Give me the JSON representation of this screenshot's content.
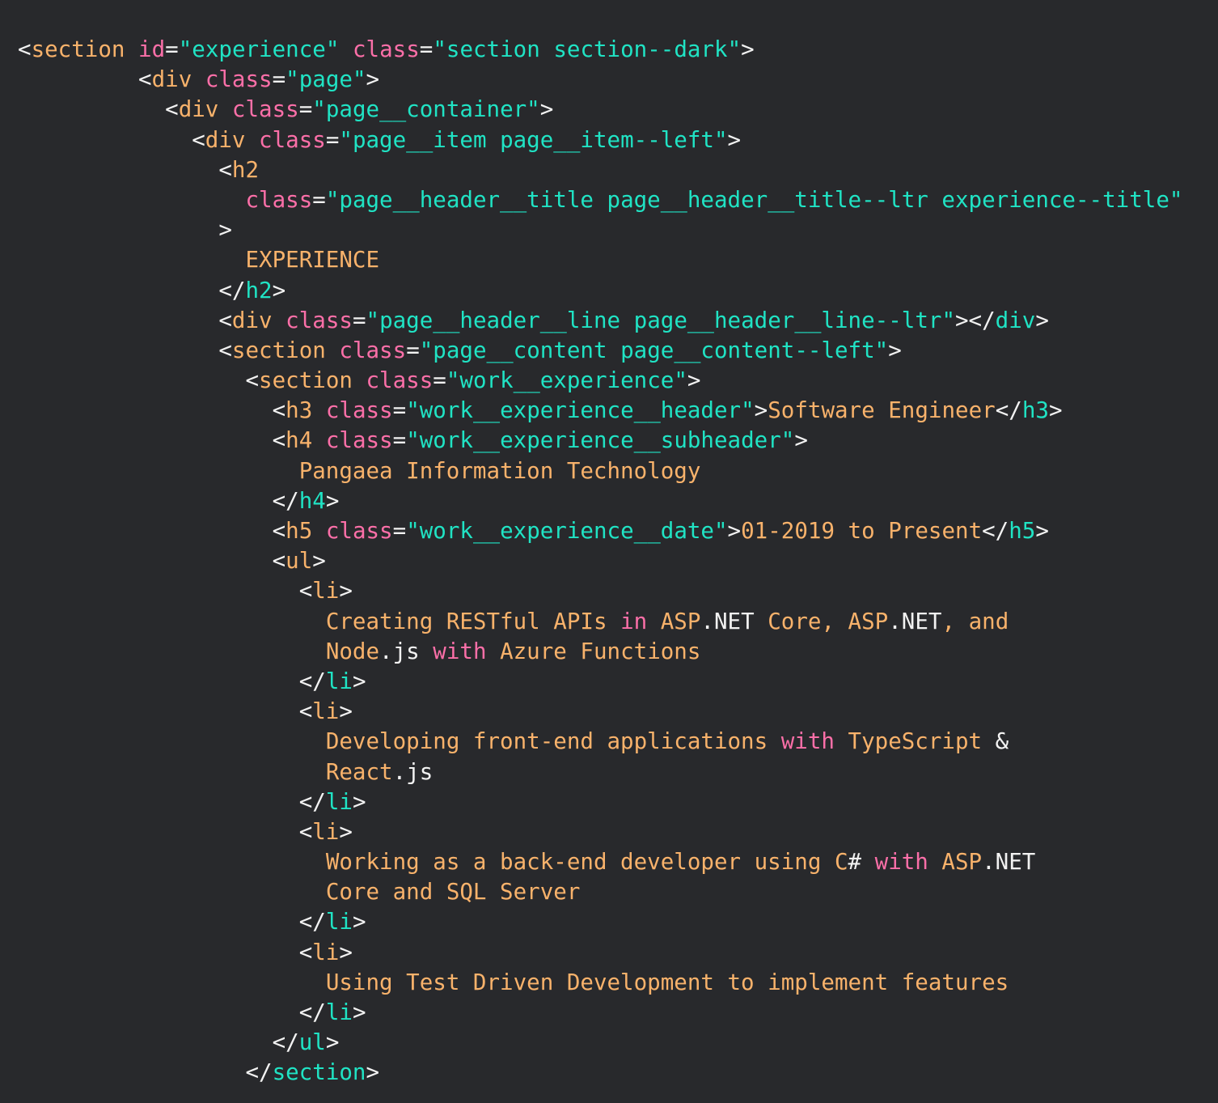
{
  "editor": {
    "theme": {
      "background": "#28292c",
      "punctuation": "#f2f2f2",
      "tag_name": "#f8b26b",
      "closing_tag_name": "#20e3c4",
      "attribute_name": "#fb6fa8",
      "string": "#20e3c4",
      "text": "#f8b26b",
      "keyword": "#fb6fa8",
      "plain": "#f2f2f2"
    },
    "lines": [
      {
        "indent": 0,
        "tokens": [
          [
            "punct",
            "<"
          ],
          [
            "tag",
            "section"
          ],
          [
            "plain",
            " "
          ],
          [
            "attr",
            "id"
          ],
          [
            "punct",
            "="
          ],
          [
            "str",
            "\"experience\""
          ],
          [
            "plain",
            " "
          ],
          [
            "attr",
            "class"
          ],
          [
            "punct",
            "="
          ],
          [
            "str",
            "\"section section--dark\""
          ],
          [
            "punct",
            ">"
          ]
        ]
      },
      {
        "indent": 9,
        "tokens": [
          [
            "punct",
            "<"
          ],
          [
            "tag",
            "div"
          ],
          [
            "plain",
            " "
          ],
          [
            "attr",
            "class"
          ],
          [
            "punct",
            "="
          ],
          [
            "str",
            "\"page\""
          ],
          [
            "punct",
            ">"
          ]
        ]
      },
      {
        "indent": 11,
        "tokens": [
          [
            "punct",
            "<"
          ],
          [
            "tag",
            "div"
          ],
          [
            "plain",
            " "
          ],
          [
            "attr",
            "class"
          ],
          [
            "punct",
            "="
          ],
          [
            "str",
            "\"page__container\""
          ],
          [
            "punct",
            ">"
          ]
        ]
      },
      {
        "indent": 13,
        "tokens": [
          [
            "punct",
            "<"
          ],
          [
            "tag",
            "div"
          ],
          [
            "plain",
            " "
          ],
          [
            "attr",
            "class"
          ],
          [
            "punct",
            "="
          ],
          [
            "str",
            "\"page__item page__item--left\""
          ],
          [
            "punct",
            ">"
          ]
        ]
      },
      {
        "indent": 15,
        "tokens": [
          [
            "punct",
            "<"
          ],
          [
            "tag",
            "h2"
          ]
        ]
      },
      {
        "indent": 17,
        "tokens": [
          [
            "attr",
            "class"
          ],
          [
            "punct",
            "="
          ],
          [
            "str",
            "\"page__header__title page__header__title--ltr experience--title\""
          ]
        ]
      },
      {
        "indent": 15,
        "tokens": [
          [
            "punct",
            ">"
          ]
        ]
      },
      {
        "indent": 17,
        "tokens": [
          [
            "text",
            "EXPERIENCE"
          ]
        ]
      },
      {
        "indent": 15,
        "tokens": [
          [
            "punct",
            "</"
          ],
          [
            "ctag",
            "h2"
          ],
          [
            "punct",
            ">"
          ]
        ]
      },
      {
        "indent": 15,
        "tokens": [
          [
            "punct",
            "<"
          ],
          [
            "tag",
            "div"
          ],
          [
            "plain",
            " "
          ],
          [
            "attr",
            "class"
          ],
          [
            "punct",
            "="
          ],
          [
            "str",
            "\"page__header__line page__header__line--ltr\""
          ],
          [
            "punct",
            "></"
          ],
          [
            "ctag",
            "div"
          ],
          [
            "punct",
            ">"
          ]
        ]
      },
      {
        "indent": 15,
        "tokens": [
          [
            "punct",
            "<"
          ],
          [
            "tag",
            "section"
          ],
          [
            "plain",
            " "
          ],
          [
            "attr",
            "class"
          ],
          [
            "punct",
            "="
          ],
          [
            "str",
            "\"page__content page__content--left\""
          ],
          [
            "punct",
            ">"
          ]
        ]
      },
      {
        "indent": 17,
        "tokens": [
          [
            "punct",
            "<"
          ],
          [
            "tag",
            "section"
          ],
          [
            "plain",
            " "
          ],
          [
            "attr",
            "class"
          ],
          [
            "punct",
            "="
          ],
          [
            "str",
            "\"work__experience\""
          ],
          [
            "punct",
            ">"
          ]
        ]
      },
      {
        "indent": 19,
        "tokens": [
          [
            "punct",
            "<"
          ],
          [
            "tag",
            "h3"
          ],
          [
            "plain",
            " "
          ],
          [
            "attr",
            "class"
          ],
          [
            "punct",
            "="
          ],
          [
            "str",
            "\"work__experience__header\""
          ],
          [
            "punct",
            ">"
          ],
          [
            "text",
            "Software Engineer"
          ],
          [
            "punct",
            "</"
          ],
          [
            "ctag",
            "h3"
          ],
          [
            "punct",
            ">"
          ]
        ]
      },
      {
        "indent": 19,
        "tokens": [
          [
            "punct",
            "<"
          ],
          [
            "tag",
            "h4"
          ],
          [
            "plain",
            " "
          ],
          [
            "attr",
            "class"
          ],
          [
            "punct",
            "="
          ],
          [
            "str",
            "\"work__experience__subheader\""
          ],
          [
            "punct",
            ">"
          ]
        ]
      },
      {
        "indent": 21,
        "tokens": [
          [
            "text",
            "Pangaea Information Technology"
          ]
        ]
      },
      {
        "indent": 19,
        "tokens": [
          [
            "punct",
            "</"
          ],
          [
            "ctag",
            "h4"
          ],
          [
            "punct",
            ">"
          ]
        ]
      },
      {
        "indent": 19,
        "tokens": [
          [
            "punct",
            "<"
          ],
          [
            "tag",
            "h5"
          ],
          [
            "plain",
            " "
          ],
          [
            "attr",
            "class"
          ],
          [
            "punct",
            "="
          ],
          [
            "str",
            "\"work__experience__date\""
          ],
          [
            "punct",
            ">"
          ],
          [
            "text",
            "01-2019 to Present"
          ],
          [
            "punct",
            "</"
          ],
          [
            "ctag",
            "h5"
          ],
          [
            "punct",
            ">"
          ]
        ]
      },
      {
        "indent": 19,
        "tokens": [
          [
            "punct",
            "<"
          ],
          [
            "tag",
            "ul"
          ],
          [
            "punct",
            ">"
          ]
        ]
      },
      {
        "indent": 21,
        "tokens": [
          [
            "punct",
            "<"
          ],
          [
            "tag",
            "li"
          ],
          [
            "punct",
            ">"
          ]
        ]
      },
      {
        "indent": 23,
        "tokens": [
          [
            "text",
            "Creating RESTful APIs "
          ],
          [
            "kw",
            "in"
          ],
          [
            "text",
            " ASP"
          ],
          [
            "plain",
            ".NET"
          ],
          [
            "text",
            " Core, ASP"
          ],
          [
            "plain",
            ".NET"
          ],
          [
            "text",
            ", and"
          ]
        ]
      },
      {
        "indent": 23,
        "tokens": [
          [
            "text",
            "Node"
          ],
          [
            "plain",
            ".js"
          ],
          [
            "text",
            " "
          ],
          [
            "kw",
            "with"
          ],
          [
            "text",
            " Azure Functions"
          ]
        ]
      },
      {
        "indent": 21,
        "tokens": [
          [
            "punct",
            "</"
          ],
          [
            "ctag",
            "li"
          ],
          [
            "punct",
            ">"
          ]
        ]
      },
      {
        "indent": 21,
        "tokens": [
          [
            "punct",
            "<"
          ],
          [
            "tag",
            "li"
          ],
          [
            "punct",
            ">"
          ]
        ]
      },
      {
        "indent": 23,
        "tokens": [
          [
            "text",
            "Developing front-end applications "
          ],
          [
            "kw",
            "with"
          ],
          [
            "text",
            " TypeScript "
          ],
          [
            "plain",
            "&"
          ]
        ]
      },
      {
        "indent": 23,
        "tokens": [
          [
            "text",
            "React"
          ],
          [
            "plain",
            ".js"
          ]
        ]
      },
      {
        "indent": 21,
        "tokens": [
          [
            "punct",
            "</"
          ],
          [
            "ctag",
            "li"
          ],
          [
            "punct",
            ">"
          ]
        ]
      },
      {
        "indent": 21,
        "tokens": [
          [
            "punct",
            "<"
          ],
          [
            "tag",
            "li"
          ],
          [
            "punct",
            ">"
          ]
        ]
      },
      {
        "indent": 23,
        "tokens": [
          [
            "text",
            "Working as a back-end developer using C"
          ],
          [
            "plain",
            "#"
          ],
          [
            "text",
            " "
          ],
          [
            "kw",
            "with"
          ],
          [
            "text",
            " ASP"
          ],
          [
            "plain",
            ".NET"
          ]
        ]
      },
      {
        "indent": 23,
        "tokens": [
          [
            "text",
            "Core and SQL Server"
          ]
        ]
      },
      {
        "indent": 21,
        "tokens": [
          [
            "punct",
            "</"
          ],
          [
            "ctag",
            "li"
          ],
          [
            "punct",
            ">"
          ]
        ]
      },
      {
        "indent": 21,
        "tokens": [
          [
            "punct",
            "<"
          ],
          [
            "tag",
            "li"
          ],
          [
            "punct",
            ">"
          ]
        ]
      },
      {
        "indent": 23,
        "tokens": [
          [
            "text",
            "Using Test Driven Development to implement features"
          ]
        ]
      },
      {
        "indent": 21,
        "tokens": [
          [
            "punct",
            "</"
          ],
          [
            "ctag",
            "li"
          ],
          [
            "punct",
            ">"
          ]
        ]
      },
      {
        "indent": 19,
        "tokens": [
          [
            "punct",
            "</"
          ],
          [
            "ctag",
            "ul"
          ],
          [
            "punct",
            ">"
          ]
        ]
      },
      {
        "indent": 17,
        "tokens": [
          [
            "punct",
            "</"
          ],
          [
            "ctag",
            "section"
          ],
          [
            "punct",
            ">"
          ]
        ]
      }
    ]
  }
}
